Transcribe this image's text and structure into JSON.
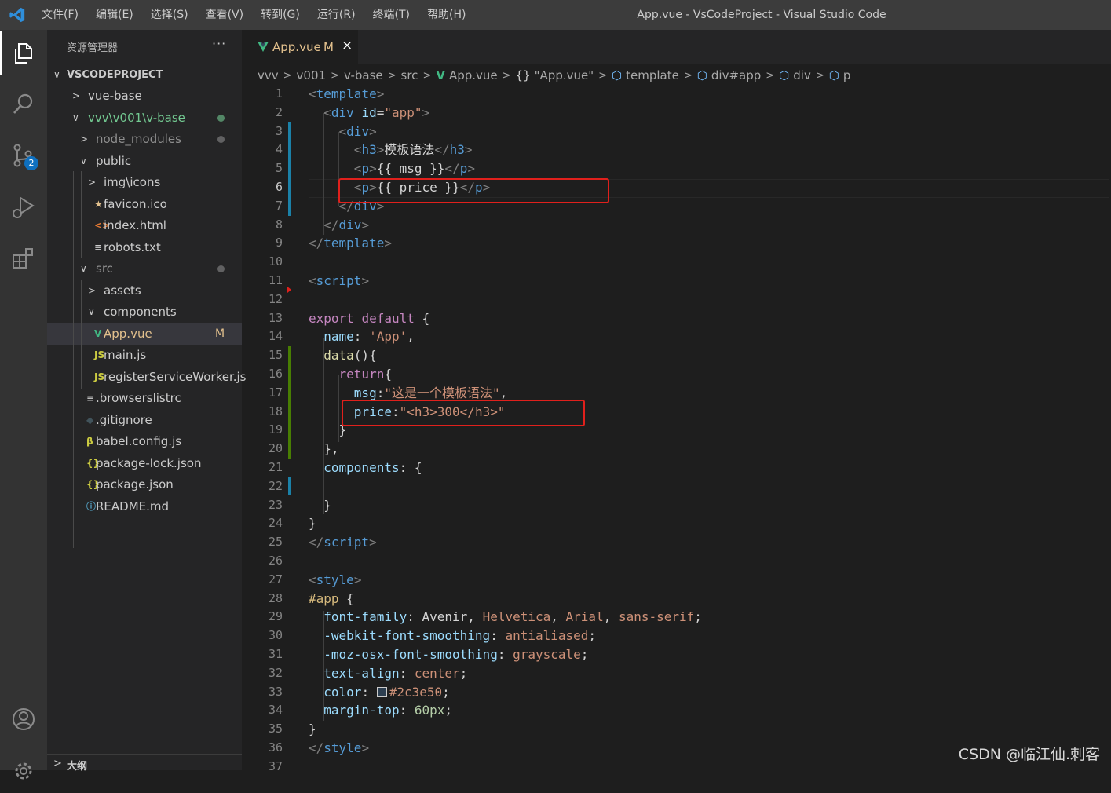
{
  "titlebar": {
    "menus": [
      "文件(F)",
      "编辑(E)",
      "选择(S)",
      "查看(V)",
      "转到(G)",
      "运行(R)",
      "终端(T)",
      "帮助(H)"
    ],
    "window_title": "App.vue - VsCodeProject - Visual Studio Code"
  },
  "activity_bar": {
    "items": [
      "explorer-icon",
      "search-icon",
      "source-control-icon",
      "run-debug-icon",
      "extensions-icon",
      "account-icon",
      "settings-gear-icon"
    ],
    "scm_badge": "2"
  },
  "sidebar": {
    "header": "资源管理器",
    "more": "···",
    "root": "VSCODEPROJECT",
    "tree": [
      {
        "label": "vue-base",
        "depth": 1,
        "chevron": ">"
      },
      {
        "label": "vvv\\v001\\v-base",
        "depth": 1,
        "chevron": "v",
        "dot": true
      },
      {
        "label": "node_modules",
        "depth": 2,
        "chevron": ">",
        "dot": "gray"
      },
      {
        "label": "public",
        "depth": 2,
        "chevron": "v"
      },
      {
        "label": "img\\icons",
        "depth": 3,
        "chevron": ">"
      },
      {
        "label": "favicon.ico",
        "depth": 3,
        "icon": "★"
      },
      {
        "label": "index.html",
        "depth": 3,
        "icon": "<>"
      },
      {
        "label": "robots.txt",
        "depth": 3,
        "icon": "≡"
      },
      {
        "label": "src",
        "depth": 2,
        "chevron": "v",
        "dot": "gray"
      },
      {
        "label": "assets",
        "depth": 3,
        "chevron": ">"
      },
      {
        "label": "components",
        "depth": 3,
        "chevron": "v"
      },
      {
        "label": "App.vue",
        "depth": 3,
        "icon": "V",
        "modified": "M",
        "selected": true
      },
      {
        "label": "main.js",
        "depth": 3,
        "icon": "JS"
      },
      {
        "label": "registerServiceWorker.js",
        "depth": 3,
        "icon": "JS"
      },
      {
        "label": ".browserslistrc",
        "depth": 2,
        "icon": "≡"
      },
      {
        "label": ".gitignore",
        "depth": 2,
        "icon": "◆"
      },
      {
        "label": "babel.config.js",
        "depth": 2,
        "icon": "β"
      },
      {
        "label": "package-lock.json",
        "depth": 2,
        "icon": "{}"
      },
      {
        "label": "package.json",
        "depth": 2,
        "icon": "{}"
      },
      {
        "label": "README.md",
        "depth": 2,
        "icon": "ⓘ"
      }
    ],
    "outline": "大纲"
  },
  "tab": {
    "name": "App.vue",
    "modified": "M",
    "close": "×"
  },
  "breadcrumb": [
    {
      "label": "vvv"
    },
    {
      "label": "v001"
    },
    {
      "label": "v-base"
    },
    {
      "label": "src"
    },
    {
      "label": "App.vue",
      "icon": "V"
    },
    {
      "label": "\"App.vue\"",
      "icon": "{}"
    },
    {
      "label": "template",
      "icon": "⬡"
    },
    {
      "label": "div#app",
      "icon": "⬡"
    },
    {
      "label": "div",
      "icon": "⬡"
    },
    {
      "label": "p",
      "icon": "⬡"
    }
  ],
  "editor": {
    "current_line": 6,
    "line_count": 37,
    "lines": [
      [
        [
          "tg",
          "<"
        ],
        [
          "t",
          "template"
        ],
        [
          "tg",
          ">"
        ]
      ],
      [
        [
          "p",
          "  "
        ],
        [
          "tg",
          "<"
        ],
        [
          "t",
          "div"
        ],
        [
          "p",
          " "
        ],
        [
          "at",
          "id"
        ],
        [
          "p",
          "="
        ],
        [
          "s",
          "\"app\""
        ],
        [
          "tg",
          ">"
        ]
      ],
      [
        [
          "p",
          "    "
        ],
        [
          "tg",
          "<"
        ],
        [
          "t",
          "div"
        ],
        [
          "tg",
          ">"
        ]
      ],
      [
        [
          "p",
          "      "
        ],
        [
          "tg",
          "<"
        ],
        [
          "t",
          "h3"
        ],
        [
          "tg",
          ">"
        ],
        [
          "p",
          "模板语法"
        ],
        [
          "tg",
          "</"
        ],
        [
          "t",
          "h3"
        ],
        [
          "tg",
          ">"
        ]
      ],
      [
        [
          "p",
          "      "
        ],
        [
          "tg",
          "<"
        ],
        [
          "t",
          "p"
        ],
        [
          "tg",
          ">"
        ],
        [
          "p",
          "{{ msg }}"
        ],
        [
          "tg",
          "</"
        ],
        [
          "t",
          "p"
        ],
        [
          "tg",
          ">"
        ]
      ],
      [
        [
          "p",
          "      "
        ],
        [
          "tg",
          "<"
        ],
        [
          "t",
          "p"
        ],
        [
          "tg",
          ">"
        ],
        [
          "p",
          "{{ price }}"
        ],
        [
          "tg",
          "</"
        ],
        [
          "t",
          "p"
        ],
        [
          "tg",
          ">"
        ]
      ],
      [
        [
          "p",
          "    "
        ],
        [
          "tg",
          "</"
        ],
        [
          "t",
          "div"
        ],
        [
          "tg",
          ">"
        ]
      ],
      [
        [
          "p",
          "  "
        ],
        [
          "tg",
          "</"
        ],
        [
          "t",
          "div"
        ],
        [
          "tg",
          ">"
        ]
      ],
      [
        [
          "tg",
          "</"
        ],
        [
          "t",
          "template"
        ],
        [
          "tg",
          ">"
        ]
      ],
      [],
      [
        [
          "tg",
          "<"
        ],
        [
          "t",
          "script"
        ],
        [
          "tg",
          ">"
        ]
      ],
      [],
      [
        [
          "kw",
          "export"
        ],
        [
          "p",
          " "
        ],
        [
          "kw",
          "default"
        ],
        [
          "p",
          " {"
        ]
      ],
      [
        [
          "p",
          "  "
        ],
        [
          "pr",
          "name"
        ],
        [
          "p",
          ": "
        ],
        [
          "s",
          "'App'"
        ],
        [
          "p",
          ","
        ]
      ],
      [
        [
          "p",
          "  "
        ],
        [
          "fn",
          "data"
        ],
        [
          "p",
          "(){"
        ]
      ],
      [
        [
          "p",
          "    "
        ],
        [
          "kw",
          "return"
        ],
        [
          "p",
          "{"
        ]
      ],
      [
        [
          "p",
          "      "
        ],
        [
          "pr",
          "msg"
        ],
        [
          "p",
          ":"
        ],
        [
          "s",
          "\"这是一个模板语法\""
        ],
        [
          "p",
          ","
        ]
      ],
      [
        [
          "p",
          "      "
        ],
        [
          "pr",
          "price"
        ],
        [
          "p",
          ":"
        ],
        [
          "s",
          "\"<h3>300</h3>\""
        ]
      ],
      [
        [
          "p",
          "    }"
        ]
      ],
      [
        [
          "p",
          "  },"
        ]
      ],
      [
        [
          "p",
          "  "
        ],
        [
          "pr",
          "components"
        ],
        [
          "p",
          ": {"
        ]
      ],
      [],
      [
        [
          "p",
          "  }"
        ]
      ],
      [
        [
          "p",
          "}"
        ]
      ],
      [
        [
          "tg",
          "</"
        ],
        [
          "t",
          "script"
        ],
        [
          "tg",
          ">"
        ]
      ],
      [],
      [
        [
          "tg",
          "<"
        ],
        [
          "t",
          "style"
        ],
        [
          "tg",
          ">"
        ]
      ],
      [
        [
          "sel",
          "#app"
        ],
        [
          "p",
          " {"
        ]
      ],
      [
        [
          "p",
          "  "
        ],
        [
          "pr",
          "font-family"
        ],
        [
          "p",
          ": Avenir, "
        ],
        [
          "s",
          "Helvetica"
        ],
        [
          "p",
          ", "
        ],
        [
          "s",
          "Arial"
        ],
        [
          "p",
          ", "
        ],
        [
          "s",
          "sans-serif"
        ],
        [
          "p",
          ";"
        ]
      ],
      [
        [
          "p",
          "  "
        ],
        [
          "pr",
          "-webkit-font-smoothing"
        ],
        [
          "p",
          ": "
        ],
        [
          "s",
          "antialiased"
        ],
        [
          "p",
          ";"
        ]
      ],
      [
        [
          "p",
          "  "
        ],
        [
          "pr",
          "-moz-osx-font-smoothing"
        ],
        [
          "p",
          ": "
        ],
        [
          "s",
          "grayscale"
        ],
        [
          "p",
          ";"
        ]
      ],
      [
        [
          "p",
          "  "
        ],
        [
          "pr",
          "text-align"
        ],
        [
          "p",
          ": "
        ],
        [
          "s",
          "center"
        ],
        [
          "p",
          ";"
        ]
      ],
      [
        [
          "p",
          "  "
        ],
        [
          "pr",
          "color"
        ],
        [
          "p",
          ": "
        ],
        [
          "swatch",
          ""
        ],
        [
          "s",
          "#2c3e50"
        ],
        [
          "p",
          ";"
        ]
      ],
      [
        [
          "p",
          "  "
        ],
        [
          "pr",
          "margin-top"
        ],
        [
          "p",
          ": "
        ],
        [
          "num",
          "60px"
        ],
        [
          "p",
          ";"
        ]
      ],
      [
        [
          "p",
          "}"
        ]
      ],
      [
        [
          "tg",
          "</"
        ],
        [
          "t",
          "style"
        ],
        [
          "tg",
          ">"
        ]
      ],
      []
    ]
  },
  "watermark": "CSDN @临江仙.刺客",
  "colors": {
    "accent": "#0e70c0",
    "highlight_box": "#e0201c",
    "modified": "#e2c08d",
    "vue_green": "#41b883"
  }
}
